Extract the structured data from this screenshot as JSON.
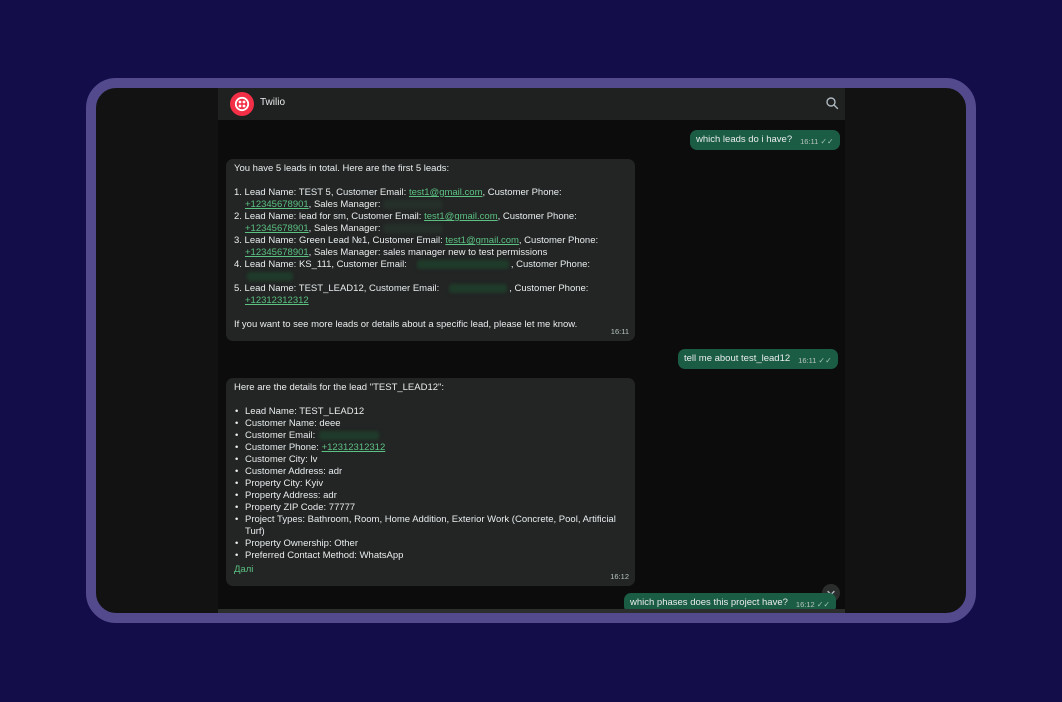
{
  "header": {
    "title": "Twilio"
  },
  "messages": {
    "out1": {
      "text": "which leads do i have?",
      "time": "16:11"
    },
    "in1": {
      "intro": "You have 5 leads in total. Here are the first 5 leads:",
      "l1a": "1. Lead Name: TEST 5, Customer Email: ",
      "l1_email": "test1@gmail.com",
      "l1b": ", Customer Phone:",
      "l1_phone": "+12345678901",
      "l1c": ", Sales Manager:",
      "l2a": "2. Lead Name: lead for sm, Customer Email: ",
      "l2_email": "test1@gmail.com",
      "l2b": ", Customer Phone:",
      "l2_phone": "+12345678901",
      "l2c": ", Sales Manager:",
      "l3a": "3. Lead Name: Green Lead №1, Customer Email: ",
      "l3_email": "test1@gmail.com",
      "l3b": ", Customer Phone:",
      "l3_phone": "+12345678901",
      "l3c": ", Sales Manager: sales manager new to test permissions",
      "l4a": "4. Lead Name: KS_111, Customer Email:",
      "l4b": ", Customer Phone:",
      "l5a": "5. Lead Name: TEST_LEAD12, Customer Email:",
      "l5b": ", Customer Phone:",
      "l5_phone": "+12312312312",
      "outro": "If you want to see more leads or details about a specific lead, please let me know.",
      "time": "16:11"
    },
    "out2": {
      "text": "tell me about test_lead12",
      "time": "16:11"
    },
    "in2": {
      "intro": "Here are the details for the lead \"TEST_LEAD12\":",
      "b1": "Lead Name: TEST_LEAD12",
      "b2": "Customer Name: deee",
      "b3": "Customer Email:",
      "b4": "Customer Phone: ",
      "b4_phone": "+12312312312",
      "b5": "Customer City: lv",
      "b6": "Customer Address: adr",
      "b7": "Property City: Kyiv",
      "b8": "Property Address: adr",
      "b9": "Property ZIP Code: 77777",
      "b10a": "Project Types: Bathroom, Room, Home Addition, Exterior Work (Concrete, Pool, Artificial",
      "b10b": "Turf)",
      "b11": "Property Ownership: Other",
      "b12": "Preferred Contact Method: WhatsApp",
      "more": "Далі",
      "time": "16:12"
    },
    "out3": {
      "text": "which phases does this project have?",
      "time": "16:12"
    }
  },
  "icons": {
    "avatar": "twilio-logo",
    "search": "search-icon",
    "read": "double-check-icon",
    "scroll": "chevron-down-icon"
  },
  "colors": {
    "background": "#130d4a",
    "frame": "#534a8d",
    "outgoing": "#1b5c44",
    "incoming": "#222524",
    "link": "#5cc183"
  }
}
